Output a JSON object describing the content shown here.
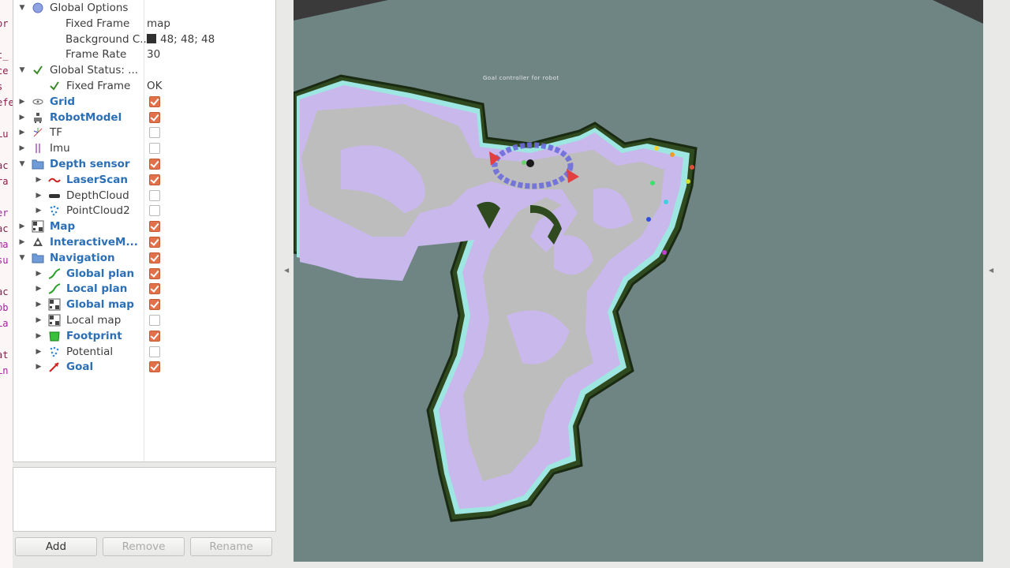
{
  "terminal_lines": [
    {
      "t": "",
      "c": "r"
    },
    {
      "t": "or",
      "c": "r"
    },
    {
      "t": "",
      "c": "r"
    },
    {
      "t": "t_",
      "c": "r"
    },
    {
      "t": "ce",
      "c": "r"
    },
    {
      "t": "s",
      "c": "r"
    },
    {
      "t": "efe",
      "c": "r"
    },
    {
      "t": "",
      "c": "r"
    },
    {
      "t": "Lu",
      "c": "r"
    },
    {
      "t": "",
      "c": "r"
    },
    {
      "t": "ac",
      "c": "r"
    },
    {
      "t": "ra",
      "c": "r"
    },
    {
      "t": "",
      "c": "r"
    },
    {
      "t": "er",
      "c": "m"
    },
    {
      "t": "ac",
      "c": "r"
    },
    {
      "t": "ma",
      "c": "m"
    },
    {
      "t": "su",
      "c": "m"
    },
    {
      "t": "",
      "c": "r"
    },
    {
      "t": "ac",
      "c": "r"
    },
    {
      "t": "ob",
      "c": "m"
    },
    {
      "t": "La",
      "c": "m"
    },
    {
      "t": "",
      "c": "r"
    },
    {
      "t": "at",
      "c": "r"
    },
    {
      "t": "Ln",
      "c": "m"
    }
  ],
  "tree": [
    {
      "label": "Global Options",
      "indent": 0,
      "exp": "down",
      "icon": "globe-icon",
      "bold": false,
      "value": null,
      "cb": null
    },
    {
      "label": "Fixed Frame",
      "indent": 1,
      "exp": null,
      "icon": null,
      "bold": false,
      "value": "map",
      "cb": null
    },
    {
      "label": "Background C...",
      "indent": 1,
      "exp": null,
      "icon": null,
      "bold": false,
      "value": "48; 48; 48",
      "swatch": true,
      "cb": null
    },
    {
      "label": "Frame Rate",
      "indent": 1,
      "exp": null,
      "icon": null,
      "bold": false,
      "value": "30",
      "cb": null
    },
    {
      "label": "Global Status: ...",
      "indent": 0,
      "exp": "down",
      "icon": "check-icon",
      "bold": false,
      "value": null,
      "cb": null
    },
    {
      "label": "Fixed Frame",
      "indent": 1,
      "exp": null,
      "icon": "check-icon",
      "bold": false,
      "value": "OK",
      "cb": null
    },
    {
      "label": "Grid",
      "indent": 0,
      "exp": "right",
      "icon": "grid-icon",
      "bold": true,
      "value": null,
      "cb": true
    },
    {
      "label": "RobotModel",
      "indent": 0,
      "exp": "right",
      "icon": "robot-model-icon",
      "bold": true,
      "value": null,
      "cb": true
    },
    {
      "label": "TF",
      "indent": 0,
      "exp": "right",
      "icon": "tf-icon",
      "bold": false,
      "value": null,
      "cb": false
    },
    {
      "label": "Imu",
      "indent": 0,
      "exp": "right",
      "icon": "imu-icon",
      "bold": false,
      "value": null,
      "cb": false
    },
    {
      "label": "Depth sensor",
      "indent": 0,
      "exp": "down",
      "icon": "folder-icon",
      "bold": true,
      "value": null,
      "cb": true
    },
    {
      "label": "LaserScan",
      "indent": 1,
      "exp": "right",
      "icon": "laserscan-icon",
      "bold": true,
      "value": null,
      "cb": true
    },
    {
      "label": "DepthCloud",
      "indent": 1,
      "exp": "right",
      "icon": "depthcloud-icon",
      "bold": false,
      "value": null,
      "cb": false
    },
    {
      "label": "PointCloud2",
      "indent": 1,
      "exp": "right",
      "icon": "pointcloud-icon",
      "bold": false,
      "value": null,
      "cb": false
    },
    {
      "label": "Map",
      "indent": 0,
      "exp": "right",
      "icon": "map-icon",
      "bold": true,
      "value": null,
      "cb": true
    },
    {
      "label": "InteractiveM...",
      "indent": 0,
      "exp": "right",
      "icon": "interactive-marker-icon",
      "bold": true,
      "value": null,
      "cb": true
    },
    {
      "label": "Navigation",
      "indent": 0,
      "exp": "down",
      "icon": "folder-icon",
      "bold": true,
      "value": null,
      "cb": true
    },
    {
      "label": "Global plan",
      "indent": 1,
      "exp": "right",
      "icon": "path-icon",
      "bold": true,
      "value": null,
      "cb": true
    },
    {
      "label": "Local plan",
      "indent": 1,
      "exp": "right",
      "icon": "path-icon",
      "bold": true,
      "value": null,
      "cb": true
    },
    {
      "label": "Global map",
      "indent": 1,
      "exp": "right",
      "icon": "map-icon",
      "bold": true,
      "value": null,
      "cb": true
    },
    {
      "label": "Local map",
      "indent": 1,
      "exp": "right",
      "icon": "map-icon",
      "bold": false,
      "value": null,
      "cb": false
    },
    {
      "label": "Footprint",
      "indent": 1,
      "exp": "right",
      "icon": "footprint-icon",
      "bold": true,
      "value": null,
      "cb": true
    },
    {
      "label": "Potential",
      "indent": 1,
      "exp": "right",
      "icon": "pointcloud-icon",
      "bold": false,
      "value": null,
      "cb": false
    },
    {
      "label": "Goal",
      "indent": 1,
      "exp": "right",
      "icon": "goal-arrow-icon",
      "bold": true,
      "value": null,
      "cb": true
    }
  ],
  "buttons": {
    "add": "Add",
    "remove": "Remove",
    "rename": "Rename"
  },
  "view": {
    "overlay_text": "Goal controller for robot",
    "background_color": "#6e8584"
  },
  "colors": {
    "checked": "#e0714a",
    "bold_label": "#2b6fb6"
  }
}
